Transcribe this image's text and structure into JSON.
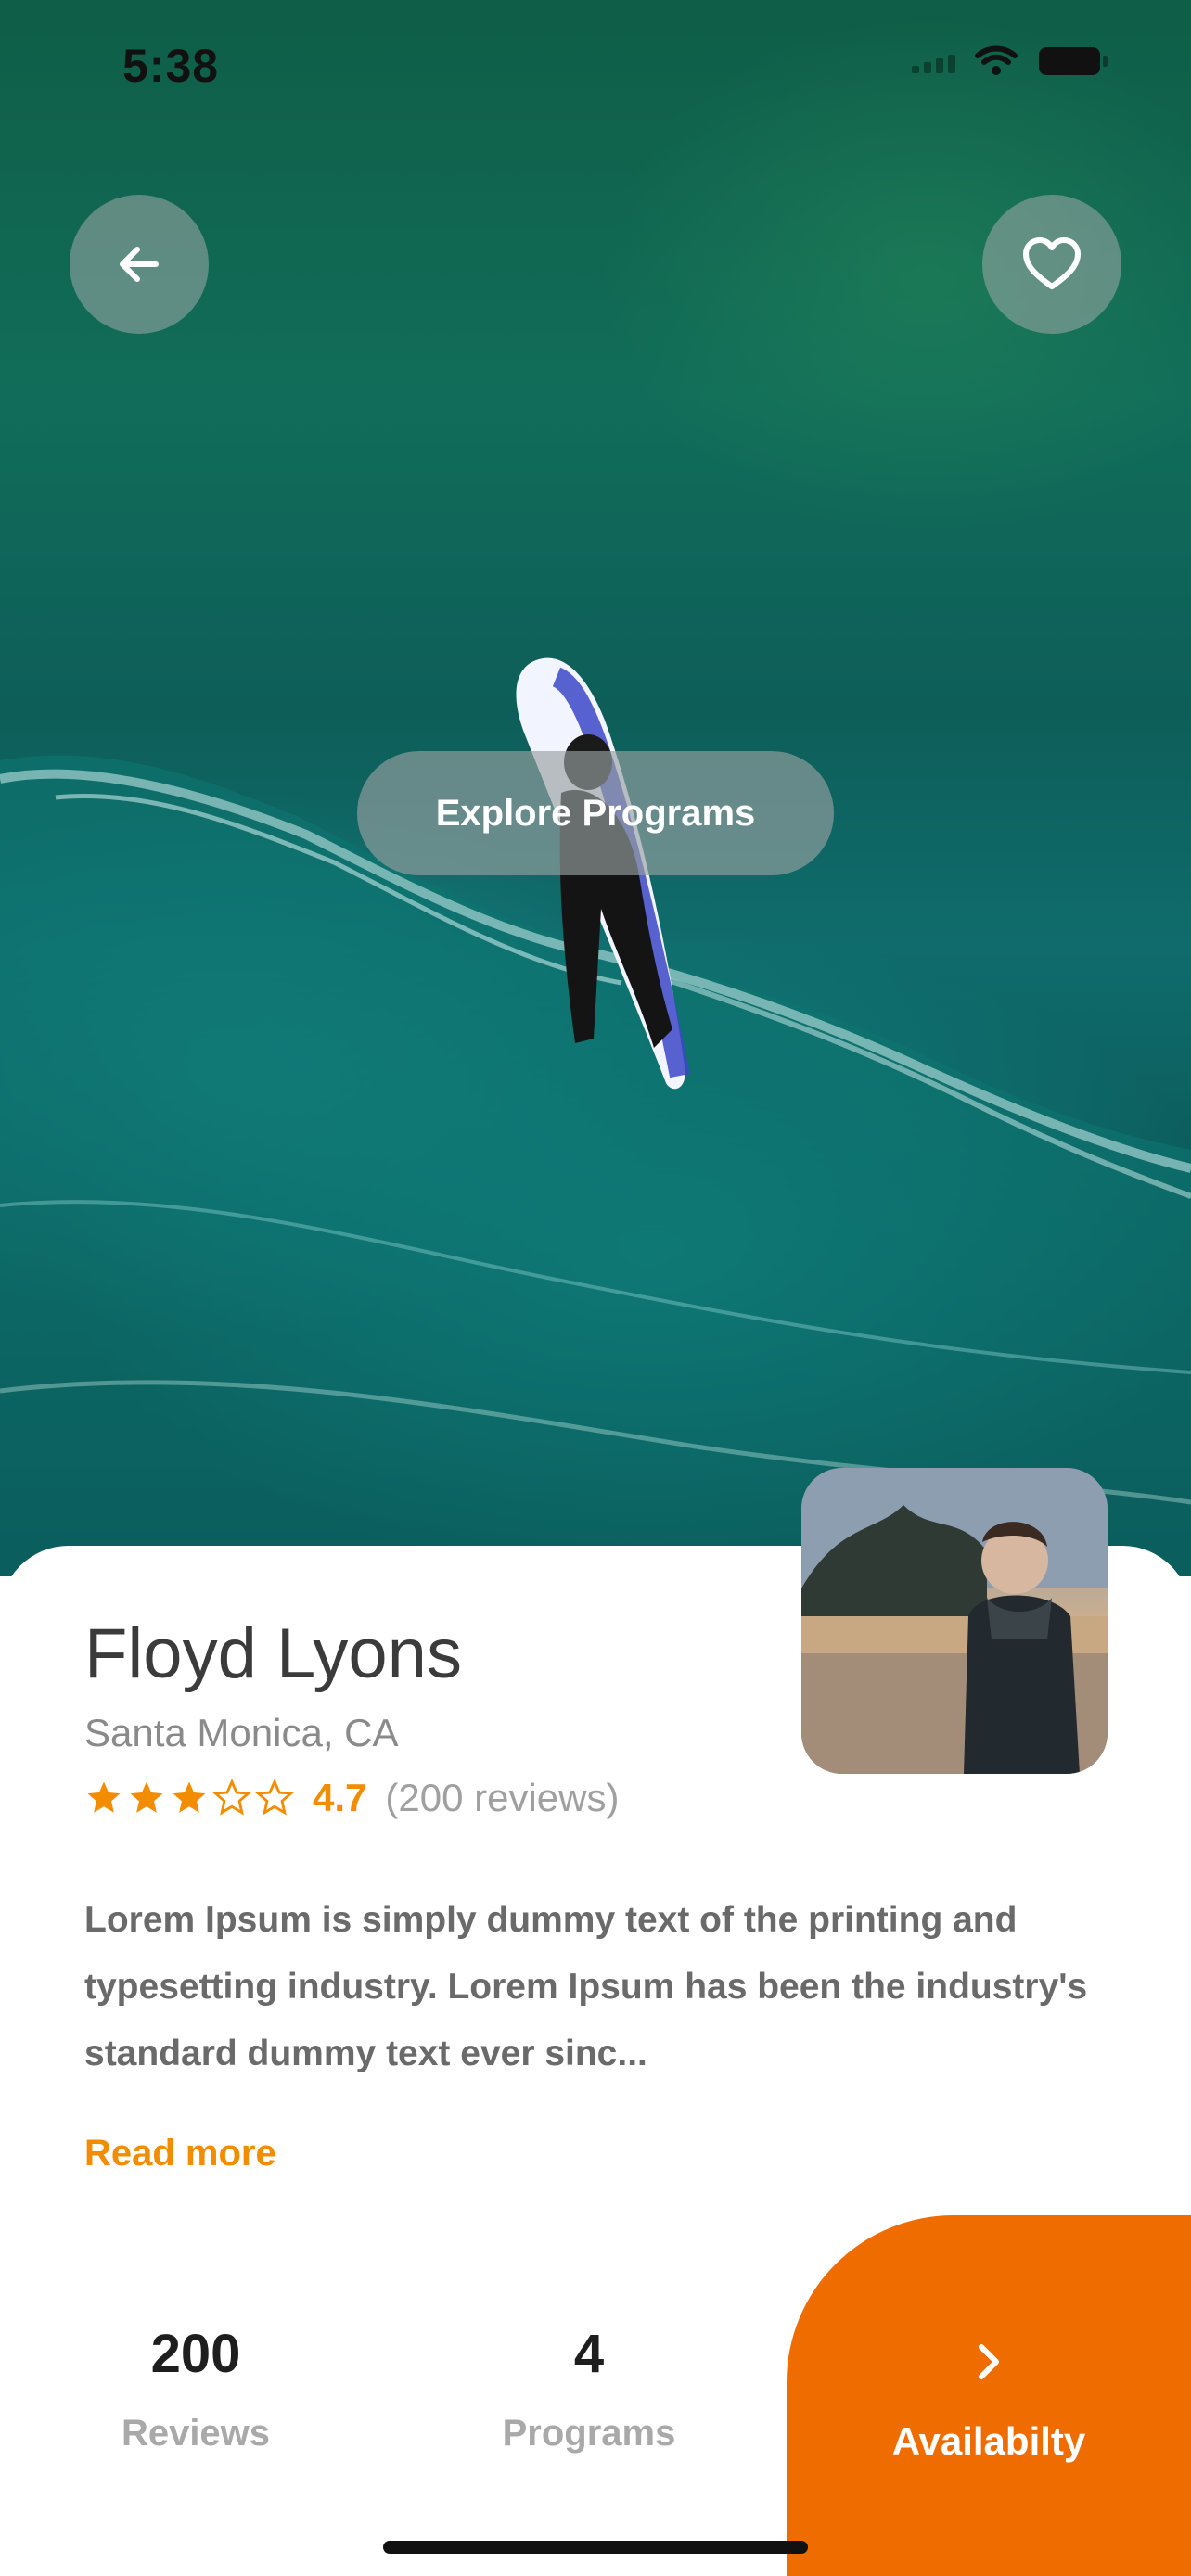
{
  "status_bar": {
    "time": "5:38"
  },
  "hero": {
    "explore_label": "Explore Programs"
  },
  "profile": {
    "name": "Floyd Lyons",
    "location": "Santa Monica, CA",
    "rating": {
      "stars_filled": 3,
      "stars_total": 5,
      "value": "4.7",
      "reviews_text": "(200 reviews)"
    },
    "description": "Lorem Ipsum is simply dummy text of the printing and typesetting industry. Lorem Ipsum has been the industry's standard dummy text ever sinc...",
    "read_more": "Read more"
  },
  "stats": [
    {
      "value": "200",
      "label": "Reviews"
    },
    {
      "value": "4",
      "label": "Programs"
    }
  ],
  "availability": {
    "label": "Availabilty"
  },
  "colors": {
    "accent": "#ef6c00",
    "rating": "#f28c00"
  },
  "icons": [
    "back-arrow-icon",
    "heart-icon",
    "star-icon",
    "chevron-right-icon",
    "wifi-icon",
    "battery-icon",
    "signal-icon"
  ]
}
